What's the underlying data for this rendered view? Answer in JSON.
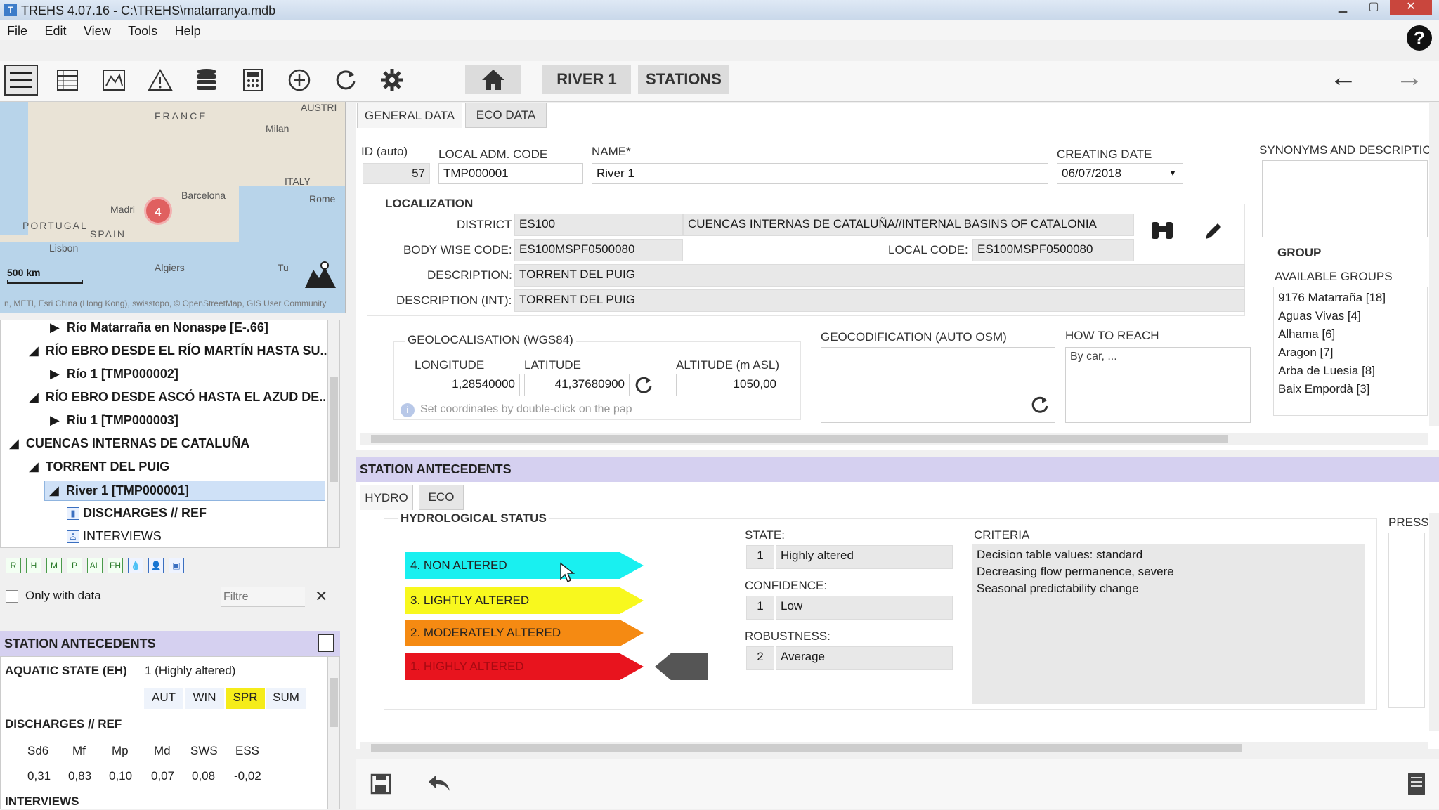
{
  "window": {
    "title": "TREHS 4.07.16 - C:\\TREHS\\matarranya.mdb",
    "minimize": "▁",
    "maximize": "▢",
    "close": "✕"
  },
  "menu": [
    "File",
    "Edit",
    "View",
    "Tools",
    "Help"
  ],
  "toolbar": {
    "icons": [
      "list-view-icon",
      "table-icon",
      "map-icon",
      "warning-icon",
      "database-icon",
      "calculator-icon",
      "add-icon",
      "refresh-icon",
      "settings-icon"
    ],
    "breadcrumb": {
      "home": "⌂",
      "river": "RIVER 1",
      "section": "STATIONS"
    },
    "back": "←",
    "forward": "→",
    "help": "?"
  },
  "map": {
    "labels": {
      "france": "FRANCE",
      "milan": "Milan",
      "italy": "ITALY",
      "rome": "Rome",
      "barcelona": "Barcelona",
      "madrid": "Madri",
      "portugal": "PORTUGAL",
      "spain": "SPAIN",
      "lisbon": "Lisbon",
      "algiers": "Algiers",
      "tunis": "Tu",
      "austri": "AUSTRI"
    },
    "cluster_count": "4",
    "scale": "500 km",
    "attribution": "n, METI, Esri China (Hong Kong), swisstopo, © OpenStreetMap, GIS User Community"
  },
  "tree": {
    "rows": [
      {
        "arrow": "▶",
        "text": "Río Matarraña en Nonaspe [E-.66]"
      },
      {
        "arrow": "◢",
        "text": "RÍO EBRO DESDE EL RÍO MARTÍN HASTA SU..."
      },
      {
        "arrow": "▶",
        "text": "Río 1 [TMP000002]"
      },
      {
        "arrow": "◢",
        "text": "RÍO EBRO DESDE ASCÓ HASTA EL AZUD DE..."
      },
      {
        "arrow": "▶",
        "text": "Riu 1 [TMP000003]"
      },
      {
        "arrow": "◢",
        "text": "CUENCAS INTERNAS DE CATALUÑA"
      },
      {
        "arrow": "◢",
        "text": "TORRENT DEL PUIG"
      },
      {
        "arrow": "◢",
        "text": "River 1 [TMP000001]"
      },
      {
        "arrow": "",
        "text": "DISCHARGES // REF"
      },
      {
        "arrow": "",
        "text": "INTERVIEWS"
      }
    ],
    "filter_icons": [
      "R",
      "H",
      "M",
      "P",
      "AL",
      "FH",
      "💧",
      "👤",
      "▣"
    ],
    "only_with_data": "Only with data",
    "filter_placeholder": "Filtre",
    "clear": "✕"
  },
  "left_antecedents": {
    "title": "STATION ANTECEDENTS",
    "aquatic_label": "AQUATIC STATE (EH)",
    "aquatic_value": "1 (Highly altered)",
    "seasons": [
      "AUT",
      "WIN",
      "SPR",
      "SUM"
    ],
    "discharges_title": "DISCHARGES // REF",
    "disch_headers": [
      "Sd6",
      "Mf",
      "Mp",
      "Md",
      "SWS",
      "ESS"
    ],
    "disch_values": [
      "0,31",
      "0,83",
      "0,10",
      "0,07",
      "0,08",
      "-0,02"
    ],
    "interviews_title": "INTERVIEWS"
  },
  "general": {
    "tabs": [
      "GENERAL DATA",
      "ECO DATA"
    ],
    "id_label": "ID (auto)",
    "id_value": "57",
    "local_adm_label": "LOCAL ADM. CODE",
    "local_adm_value": "TMP000001",
    "name_label": "NAME*",
    "name_value": "River 1",
    "creating_label": "CREATING DATE",
    "creating_value": "06/07/2018",
    "synonyms_label": "SYNONYMS AND DESCRIPTIC",
    "localization_title": "LOCALIZATION",
    "district_label": "DISTRICT",
    "district_code": "ES100",
    "district_name": "CUENCAS INTERNAS DE CATALUÑA//INTERNAL BASINS OF CATALONIA",
    "body_label": "BODY WISE CODE:",
    "body_value": "ES100MSPF0500080",
    "local_code_label": "LOCAL CODE:",
    "local_code_value": "ES100MSPF0500080",
    "desc_label": "DESCRIPTION:",
    "desc_value": "TORRENT DEL PUIG",
    "desc_int_label": "DESCRIPTION (INT):",
    "desc_int_value": "TORRENT DEL PUIG",
    "geo_title": "GEOLOCALISATION (WGS84)",
    "lon_label": "LONGITUDE",
    "lon_value": "1,28540000",
    "lat_label": "LATITUDE",
    "lat_value": "41,37680900",
    "alt_label": "ALTITUDE (m ASL)",
    "alt_value": "1050,00",
    "coord_hint": "Set coordinates by double-click on the pap",
    "geocod_title": "GEOCODIFICATION (AUTO OSM)",
    "how_title": "HOW TO REACH",
    "how_value": "By car, ...",
    "group_title": "GROUP",
    "available_groups_label": "AVAILABLE GROUPS",
    "groups": [
      "9176 Matarraña [18]",
      "Aguas Vivas [4]",
      "Alhama [6]",
      "Aragon [7]",
      "Arba de Luesia [8]",
      "Baix Empordà [3]"
    ]
  },
  "antecedents": {
    "title": "STATION ANTECEDENTS",
    "tabs": [
      "HYDRO",
      "ECO"
    ],
    "hydro_title": "HYDROLOGICAL STATUS",
    "levels": [
      {
        "label": "4. NON ALTERED",
        "color": "#19f0f0"
      },
      {
        "label": "3. LIGHTLY ALTERED",
        "color": "#f8f81e"
      },
      {
        "label": "2. MODERATELY ALTERED",
        "color": "#f58a12"
      },
      {
        "label": "1. HIGHLY ALTERED",
        "color": "#e8141e"
      }
    ],
    "state_label": "STATE:",
    "state_num": "1",
    "state_value": "Highly altered",
    "conf_label": "CONFIDENCE:",
    "conf_num": "1",
    "conf_value": "Low",
    "rob_label": "ROBUSTNESS:",
    "rob_num": "2",
    "rob_value": "Average",
    "criteria_label": "CRITERIA",
    "criteria": [
      "Decision table values: standard",
      "Decreasing flow permanence, severe",
      "Seasonal predictability change"
    ],
    "pressures_label": "PRESSU"
  }
}
